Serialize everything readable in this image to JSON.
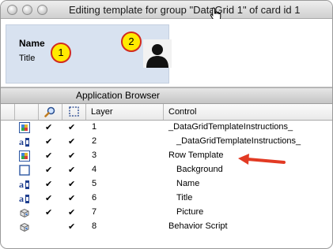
{
  "window": {
    "title": "Editing template for group \"DataGrid 1\" of card id 1"
  },
  "template": {
    "name_label": "Name",
    "title_label": "Title",
    "badge_1": "1",
    "badge_2": "2"
  },
  "app_browser": {
    "title": "Application Browser",
    "columns": {
      "layer": "Layer",
      "control": "Control"
    },
    "rows": [
      {
        "icon": "group-icon",
        "visible": "✔",
        "selected": "✔",
        "layer": "1",
        "control": "_DataGridTemplateInstructions_"
      },
      {
        "icon": "field-icon",
        "visible": "✔",
        "selected": "✔",
        "layer": "2",
        "control": "_DataGridTemplateInstructions_"
      },
      {
        "icon": "group-icon",
        "visible": "✔",
        "selected": "✔",
        "layer": "3",
        "control": "Row Template"
      },
      {
        "icon": "graphic-icon",
        "visible": "✔",
        "selected": "✔",
        "layer": "4",
        "control": "Background"
      },
      {
        "icon": "field-icon",
        "visible": "✔",
        "selected": "✔",
        "layer": "5",
        "control": "Name"
      },
      {
        "icon": "field-icon",
        "visible": "✔",
        "selected": "✔",
        "layer": "6",
        "control": "Title"
      },
      {
        "icon": "image-icon",
        "visible": "✔",
        "selected": "✔",
        "layer": "7",
        "control": "Picture"
      },
      {
        "icon": "image-icon",
        "visible": "",
        "selected": "✔",
        "layer": "8",
        "control": "Behavior Script"
      }
    ]
  },
  "colors": {
    "badge_fill": "#ffeb00",
    "badge_border": "#d22b1f",
    "arrow": "#e23a23",
    "template_bg": "#d8e2f0"
  }
}
